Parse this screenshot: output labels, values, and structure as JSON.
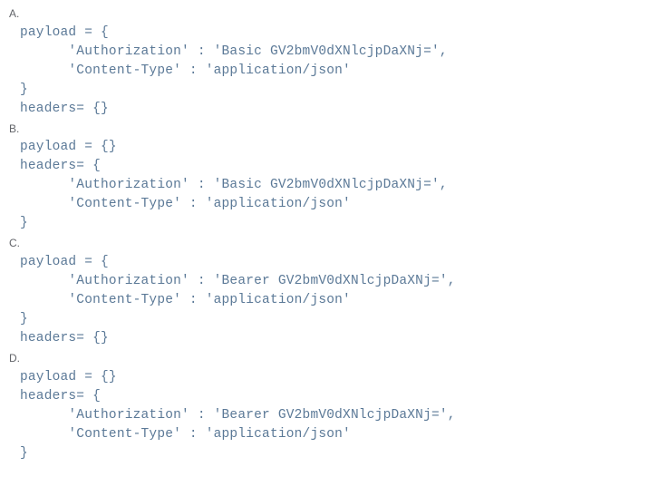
{
  "options": {
    "a": {
      "label": "A.",
      "code": "payload = {\n      'Authorization' : 'Basic GV2bmV0dXNlcjpDaXNj=',\n      'Content-Type' : 'application/json'\n}\nheaders= {}"
    },
    "b": {
      "label": "B.",
      "code": "payload = {}\nheaders= {\n      'Authorization' : 'Basic GV2bmV0dXNlcjpDaXNj=',\n      'Content-Type' : 'application/json'\n}"
    },
    "c": {
      "label": "C.",
      "code": "payload = {\n      'Authorization' : 'Bearer GV2bmV0dXNlcjpDaXNj=',\n      'Content-Type' : 'application/json'\n}\nheaders= {}"
    },
    "d": {
      "label": "D.",
      "code": "payload = {}\nheaders= {\n      'Authorization' : 'Bearer GV2bmV0dXNlcjpDaXNj=',\n      'Content-Type' : 'application/json'\n}"
    }
  }
}
